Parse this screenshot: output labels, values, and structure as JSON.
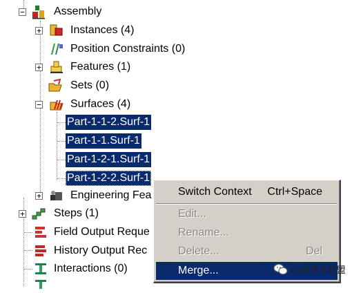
{
  "tree": {
    "assembly": "Assembly",
    "instances": "Instances (4)",
    "position_constraints": "Position Constraints (0)",
    "features": "Features (1)",
    "sets": "Sets (0)",
    "surfaces": "Surfaces (4)",
    "surf_items": [
      "Part-1-1-2.Surf-1",
      "Part-1-1.Surf-1",
      "Part-1-2-1.Surf-1",
      "Part-1-2-2.Surf-1"
    ],
    "engineering_features": "Engineering Fea",
    "steps": "Steps (1)",
    "field_output": "Field Output Reque",
    "history_output": "History Output Rec",
    "interactions": "Interactions (0)"
  },
  "context_menu": {
    "switch_context": "Switch Context",
    "switch_context_shortcut": "Ctrl+Space",
    "edit": "Edit...",
    "rename": "Rename...",
    "delete": "Delete...",
    "delete_shortcut": "Del",
    "merge": "Merge..."
  },
  "watermark": "CAE技术联盟",
  "colors": {
    "selection": "#0a2a6e",
    "menu_bg": "#d4d0c8"
  }
}
